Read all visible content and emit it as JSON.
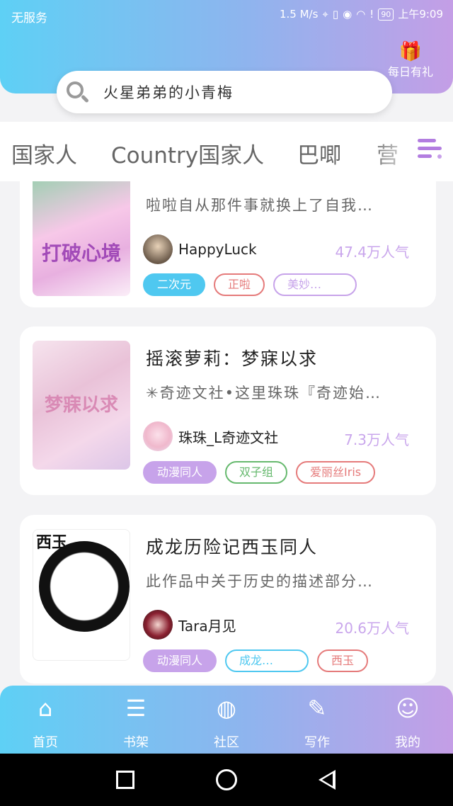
{
  "status_bar": {
    "carrier": "无服务",
    "speed": "1.5 M/s",
    "battery": "90",
    "time": "上午9:09"
  },
  "header": {
    "gift_label": "每日有礼",
    "gift_icon": "gift-icon"
  },
  "search": {
    "placeholder": "火星弟弟的小青梅"
  },
  "categories": [
    "国家人",
    "Country国家人",
    "巴唧",
    "营"
  ],
  "books": [
    {
      "title": "",
      "cover_text": "打破心境",
      "desc": "啦啦自从那件事就换上了自我…",
      "author": "HappyLuck",
      "popularity": "47.4万人气",
      "tags": [
        {
          "label": "二次元",
          "color": "#4fc8f0",
          "filled": true
        },
        {
          "label": "正啦",
          "color": "#e57a7a",
          "filled": false
        },
        {
          "label": "美妙…",
          "color": "#c7a3ea",
          "filled": false
        }
      ]
    },
    {
      "title": "摇滚萝莉：梦寐以求",
      "cover_text": "梦寐以求",
      "desc": "✳奇迹文社•这里珠珠『奇迹始…",
      "author": "珠珠_L奇迹文社",
      "popularity": "7.3万人气",
      "tags": [
        {
          "label": "动漫同人",
          "color": "#c7a3ea",
          "filled": true
        },
        {
          "label": "双子组",
          "color": "#66b96e",
          "filled": false
        },
        {
          "label": "爱丽丝Iris",
          "color": "#e57a7a",
          "filled": false
        }
      ]
    },
    {
      "title": "成龙历险记西玉同人",
      "cover_text": "西玉",
      "desc": "此作品中关于历史的描述部分…",
      "author": "Tara月见",
      "popularity": "20.6万人气",
      "tags": [
        {
          "label": "动漫同人",
          "color": "#c7a3ea",
          "filled": true
        },
        {
          "label": "成龙…",
          "color": "#4fc8f0",
          "filled": false
        },
        {
          "label": "西玉",
          "color": "#e57a7a",
          "filled": false
        }
      ]
    }
  ],
  "bottom_nav": [
    {
      "label": "首页",
      "icon": "home-icon"
    },
    {
      "label": "书架",
      "icon": "bookshelf-icon"
    },
    {
      "label": "社区",
      "icon": "planet-icon"
    },
    {
      "label": "写作",
      "icon": "pen-icon"
    },
    {
      "label": "我的",
      "icon": "user-icon"
    }
  ]
}
